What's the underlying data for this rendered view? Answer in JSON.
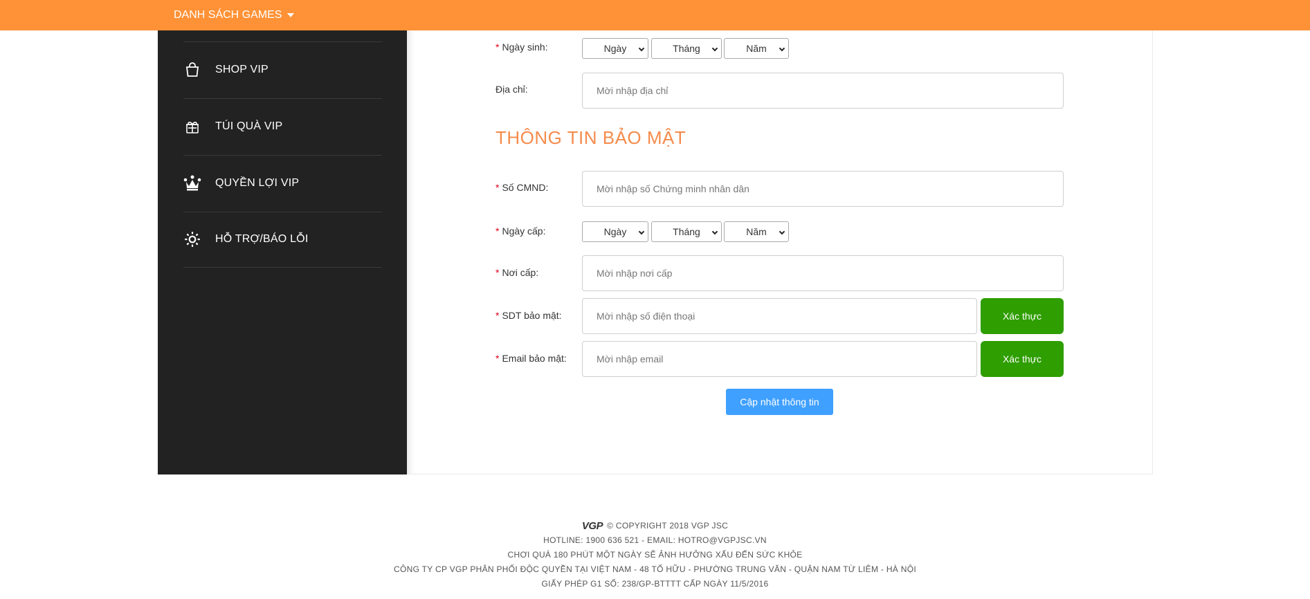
{
  "topbar": {
    "menu_label": "DANH SÁCH GAMES",
    "color": "#ff9236"
  },
  "sidebar": {
    "items": [
      {
        "label": "SHOP VIP",
        "icon": "shopping-bag-icon"
      },
      {
        "label": "TÚI QUÀ VIP",
        "icon": "gift-icon"
      },
      {
        "label": "QUYỀN LỢI VIP",
        "icon": "crown-icon"
      },
      {
        "label": "HỖ TRỢ/BÁO LỖI",
        "icon": "gear-icon"
      }
    ]
  },
  "form": {
    "birth": {
      "label": "Ngày sinh:",
      "day": "Ngày",
      "month": "Tháng",
      "year": "Năm"
    },
    "address": {
      "label": "Địa chỉ:",
      "placeholder": "Mời nhập địa chỉ"
    },
    "section_title": "THÔNG TIN BẢO MẬT",
    "id_number": {
      "label": "Số CMND:",
      "placeholder": "Mời nhập số Chứng minh nhân dân"
    },
    "issue_date": {
      "label": "Ngày cấp:",
      "day": "Ngày",
      "month": "Tháng",
      "year": "Năm"
    },
    "issue_place": {
      "label": "Nơi cấp:",
      "placeholder": "Mời nhập nơi cấp"
    },
    "security_phone": {
      "label": "SDT bảo mật:",
      "placeholder": "Mời nhập số điện thoại",
      "button": "Xác thực"
    },
    "security_email": {
      "label": "Email bảo mật:",
      "placeholder": "Mời nhập email",
      "button": "Xác thực"
    },
    "submit": "Cập nhật thông tin",
    "required_mark": "*"
  },
  "footer": {
    "logo": "VGP",
    "copyright": "© COPYRIGHT 2018 VGP JSC",
    "hotline": "HOTLINE: 1900 636 521 - EMAIL: HOTRO@VGPJSC.VN",
    "warning": "CHƠI QUÁ 180 PHÚT MỘT NGÀY SẼ ẢNH HƯỞNG XẤU ĐẾN SỨC KHỎE",
    "company": "CÔNG TY CP VGP PHÂN PHỐI ĐỘC QUYỀN TẠI VIỆT NAM - 48 TỐ HỮU - PHƯỜNG TRUNG VĂN - QUẬN NAM TỪ LIÊM - HÀ NỘI",
    "license": "GIẤY PHÉP G1 SỐ: 238/GP-BTTTT CẤP NGÀY 11/5/2016"
  },
  "colors": {
    "accent": "#f58b4c",
    "verify": "#2e9e00",
    "submit": "#3fa0ff",
    "sidebar": "#222222"
  }
}
